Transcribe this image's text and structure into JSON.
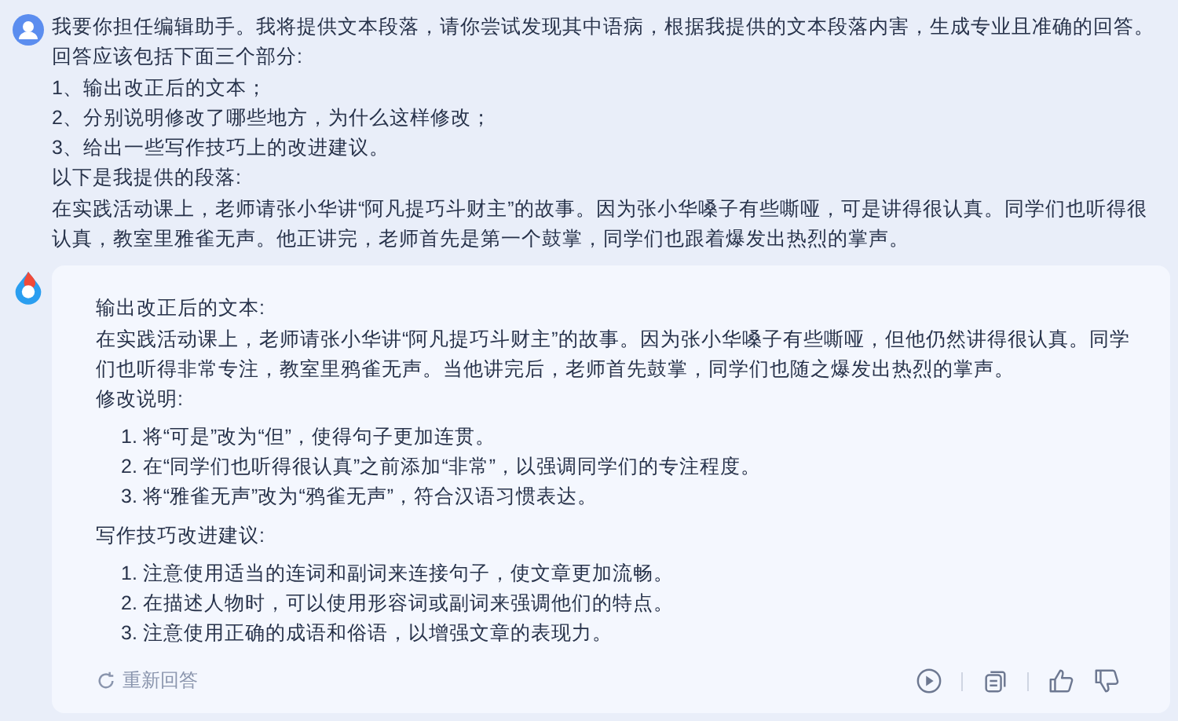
{
  "user_message": {
    "lines": [
      "我要你担任编辑助手。我将提供文本段落，请你尝试发现其中语病，根据我提供的文本段落内害，生成专业且准确的回答。回答应该包括下面三个部分:",
      "1、输出改正后的文本；",
      "2、分别说明修改了哪些地方，为什么这样修改；",
      "3、给出一些写作技巧上的改进建议。",
      "以下是我提供的段落:",
      "在实践活动课上，老师请张小华讲“阿凡提巧斗财主”的故事。因为张小华嗓子有些嘶哑，可是讲得很认真。同学们也听得很认真，教室里雅雀无声。他正讲完，老师首先是第一个鼓掌，同学们也跟着爆发出热烈的掌声。"
    ]
  },
  "answer": {
    "blocks": [
      {
        "kind": "heading",
        "text": "输出改正后的文本:"
      },
      {
        "kind": "paragraph",
        "text": "在实践活动课上，老师请张小华讲“阿凡提巧斗财主”的故事。因为张小华嗓子有些嘶哑，但他仍然讲得很认真。同学们也听得非常专注，教室里鸦雀无声。当他讲完后，老师首先鼓掌，同学们也随之爆发出热烈的掌声。"
      },
      {
        "kind": "heading",
        "text": "修改说明:"
      },
      {
        "kind": "list",
        "items": [
          "1. 将“可是”改为“但”，使得句子更加连贯。",
          "2. 在“同学们也听得很认真”之前添加“非常”，以强调同学们的专注程度。",
          "3. 将“雅雀无声”改为“鸦雀无声”，符合汉语习惯表达。"
        ]
      },
      {
        "kind": "heading",
        "text": "写作技巧改进建议:"
      },
      {
        "kind": "list",
        "items": [
          "1. 注意使用适当的连词和副词来连接句子，使文章更加流畅。",
          "2. 在描述人物时，可以使用形容词或副词来强调他们的特点。",
          "3. 注意使用正确的成语和俗语，以增强文章的表现力。"
        ]
      }
    ],
    "regenerate_label": "重新回答"
  }
}
